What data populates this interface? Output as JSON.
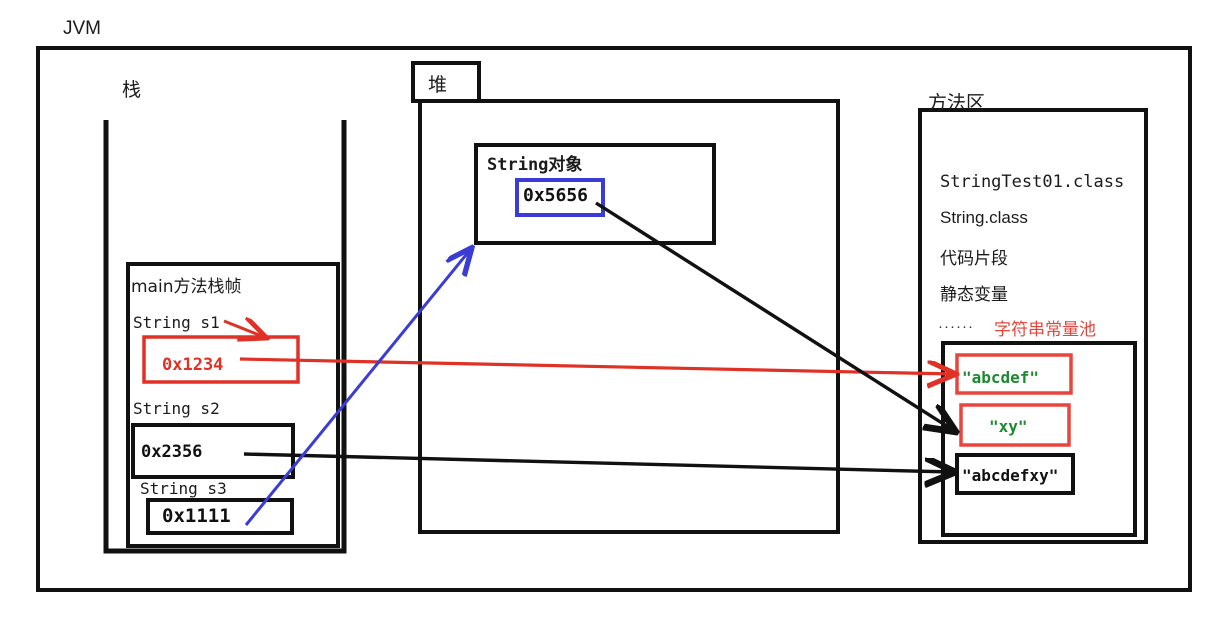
{
  "diagram": {
    "title": "JVM",
    "regions": {
      "stack": {
        "label": "栈"
      },
      "heap": {
        "label": "堆"
      },
      "method_area": {
        "label": "方法区"
      }
    },
    "stack": {
      "frame_title": "main方法栈帧",
      "variables": [
        {
          "decl": "String s1",
          "value": "0x1234",
          "color": "#e03127"
        },
        {
          "decl": "String s2",
          "value": "0x2356",
          "color": "#111111"
        },
        {
          "decl": "String s3",
          "value": "0x1111",
          "color": "#111111"
        }
      ]
    },
    "heap": {
      "object_title": "String对象",
      "object_value": "0x5656",
      "object_value_box_color": "#3b3bd6"
    },
    "method_area": {
      "entries": [
        "StringTest01.class",
        "String.class",
        "代码片段",
        "静态变量"
      ],
      "ellipsis": "······",
      "pool_label": "字符串常量池",
      "pool_label_color": "#e8453c",
      "pool_entries": [
        {
          "text": "\"abcdef\"",
          "text_color": "#1d8a30",
          "border_color": "#e8453c"
        },
        {
          "text": "\"xy\"",
          "text_color": "#1d8a30",
          "border_color": "#e8453c"
        },
        {
          "text": "\"abcdefxy\"",
          "text_color": "#111111",
          "border_color": "#111111"
        }
      ]
    },
    "arrows": [
      {
        "name": "s1-to-abcdef",
        "color": "#e03127",
        "from": "0x1234",
        "to": "\"abcdef\""
      },
      {
        "name": "s2-to-abcdefxy",
        "color": "#111111",
        "from": "0x2356",
        "to": "\"abcdefxy\""
      },
      {
        "name": "s3-to-string-object",
        "color": "#3b3bd6",
        "from": "0x1111",
        "to": "String对象"
      },
      {
        "name": "string-object-to-xy",
        "color": "#111111",
        "from": "0x5656",
        "to": "\"xy\""
      },
      {
        "name": "s1-label-pointer",
        "color": "#e03127",
        "from": "String s1",
        "to": "0x1234 box"
      }
    ],
    "colors": {
      "red": "#e03127",
      "pool_red": "#e8453c",
      "green": "#1d8a30",
      "blue": "#3b3bd6",
      "black": "#111111"
    }
  }
}
